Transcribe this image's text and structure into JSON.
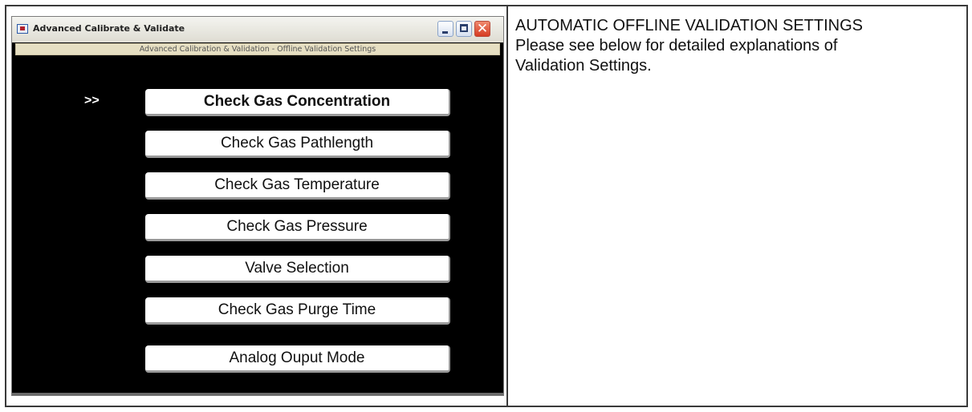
{
  "window": {
    "title": "Advanced Calibrate & Validate",
    "subtitle": "Advanced Calibration & Validation - Offline Validation Settings",
    "selection_marker": ">>",
    "close_glyph": "✕"
  },
  "menu": {
    "items": [
      {
        "label": "Check Gas Concentration",
        "selected": true
      },
      {
        "label": "Check Gas Pathlength",
        "selected": false
      },
      {
        "label": "Check Gas Temperature",
        "selected": false
      },
      {
        "label": "Check Gas Pressure",
        "selected": false
      },
      {
        "label": "Valve Selection",
        "selected": false
      },
      {
        "label": "Check Gas Purge Time",
        "selected": false
      },
      {
        "label": "Analog Ouput Mode",
        "selected": false
      }
    ]
  },
  "description": {
    "heading": "AUTOMATIC OFFLINE VALIDATION SETTINGS",
    "body_line1": "Please see below for detailed explanations of",
    "body_line2": "Validation Settings."
  },
  "icons": {
    "app": "app-window-icon",
    "minimize": "minimize-icon",
    "maximize": "maximize-icon",
    "close": "close-icon"
  },
  "colors": {
    "window_background": "#000000",
    "subtitle_bar": "#e6dfc2",
    "close_button": "#d63b22"
  }
}
